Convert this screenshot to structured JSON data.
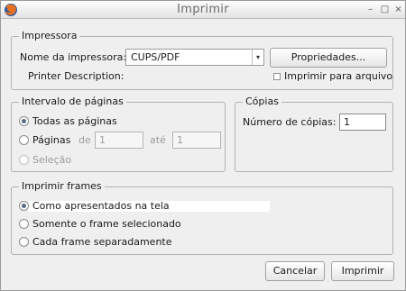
{
  "window": {
    "title": "Imprimir"
  },
  "titlebar_buttons": {
    "minimize": "–",
    "maximize": "□",
    "close": "×"
  },
  "printer": {
    "legend": "Impressora",
    "name_label": "Nome da impressora:",
    "name_value": "CUPS/PDF",
    "properties_button": "Propriedades...",
    "description_label": "Printer Description:",
    "print_to_file": "Imprimir para arquivo"
  },
  "range": {
    "legend": "Intervalo de páginas",
    "all_pages": "Todas as páginas",
    "pages": "Páginas",
    "from_label": "de",
    "from_value": "1",
    "to_label": "até",
    "to_value": "1",
    "selection": "Seleção"
  },
  "copies": {
    "legend": "Cópias",
    "count_label": "Número de cópias:",
    "count_value": "1"
  },
  "frames": {
    "legend": "Imprimir frames",
    "as_displayed": "Como apresentados na tela",
    "selected_frame": "Somente o frame selecionado",
    "each_frame": "Cada frame separadamente"
  },
  "actions": {
    "cancel": "Cancelar",
    "print": "Imprimir"
  },
  "icons": {
    "app": "firefox-icon"
  }
}
